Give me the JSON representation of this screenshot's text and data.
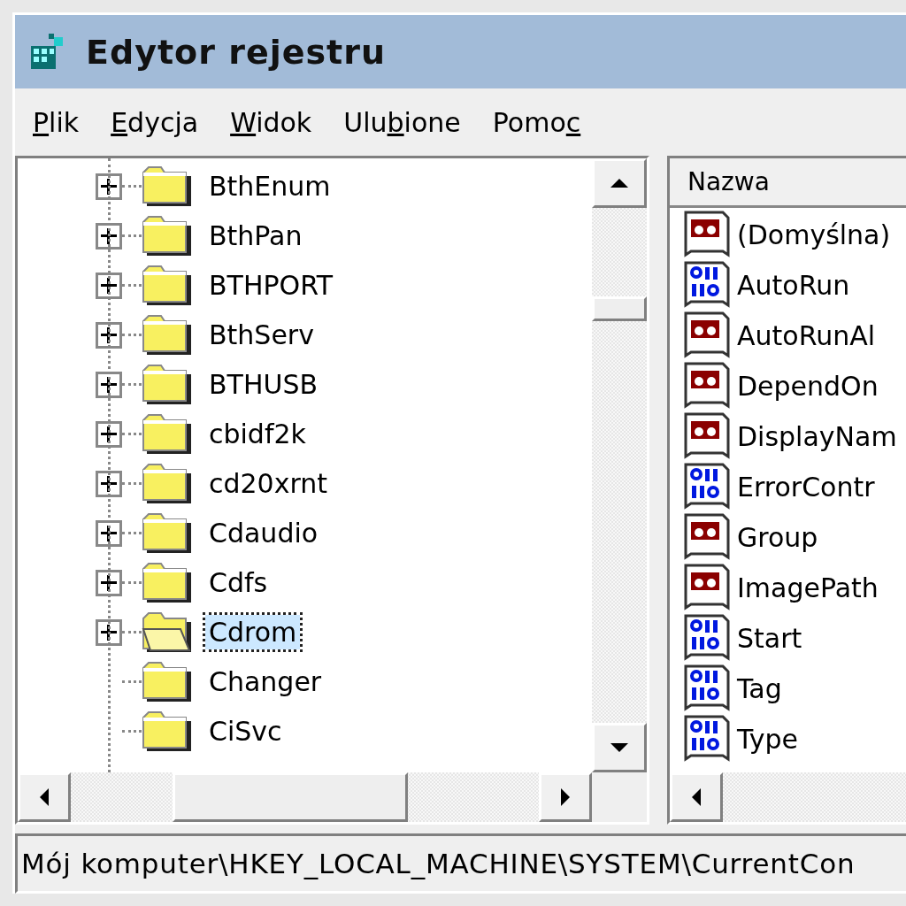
{
  "window": {
    "title": "Edytor rejestru"
  },
  "menu": [
    {
      "mnemonic": "P",
      "after": "lik"
    },
    {
      "mnemonic": "E",
      "after": "dycja"
    },
    {
      "mnemonic": "W",
      "after": "idok"
    },
    {
      "before": "Ulu",
      "mnemonic": "b",
      "after": "ione"
    },
    {
      "before": "Pomo",
      "mnemonic": "c"
    }
  ],
  "tree": {
    "items": [
      {
        "label": "BthEnum",
        "expandable": true,
        "selected": false
      },
      {
        "label": "BthPan",
        "expandable": true,
        "selected": false
      },
      {
        "label": "BTHPORT",
        "expandable": true,
        "selected": false
      },
      {
        "label": "BthServ",
        "expandable": true,
        "selected": false
      },
      {
        "label": "BTHUSB",
        "expandable": true,
        "selected": false
      },
      {
        "label": "cbidf2k",
        "expandable": true,
        "selected": false
      },
      {
        "label": "cd20xrnt",
        "expandable": true,
        "selected": false
      },
      {
        "label": "Cdaudio",
        "expandable": true,
        "selected": false
      },
      {
        "label": "Cdfs",
        "expandable": true,
        "selected": false
      },
      {
        "label": "Cdrom",
        "expandable": true,
        "selected": true
      },
      {
        "label": "Changer",
        "expandable": false,
        "selected": false
      },
      {
        "label": "CiSvc",
        "expandable": false,
        "selected": false
      }
    ]
  },
  "values": {
    "columns": [
      "Nazwa"
    ],
    "rows": [
      {
        "name": "(Domyślna)",
        "kind": "string"
      },
      {
        "name": "AutoRun",
        "kind": "dword"
      },
      {
        "name": "AutoRunAl",
        "kind": "string"
      },
      {
        "name": "DependOn",
        "kind": "string"
      },
      {
        "name": "DisplayNam",
        "kind": "string"
      },
      {
        "name": "ErrorContr",
        "kind": "dword"
      },
      {
        "name": "Group",
        "kind": "string"
      },
      {
        "name": "ImagePath",
        "kind": "string"
      },
      {
        "name": "Start",
        "kind": "dword"
      },
      {
        "name": "Tag",
        "kind": "dword"
      },
      {
        "name": "Type",
        "kind": "dword"
      }
    ]
  },
  "status_bar": "Mój komputer\\HKEY_LOCAL_MACHINE\\SYSTEM\\CurrentCon"
}
